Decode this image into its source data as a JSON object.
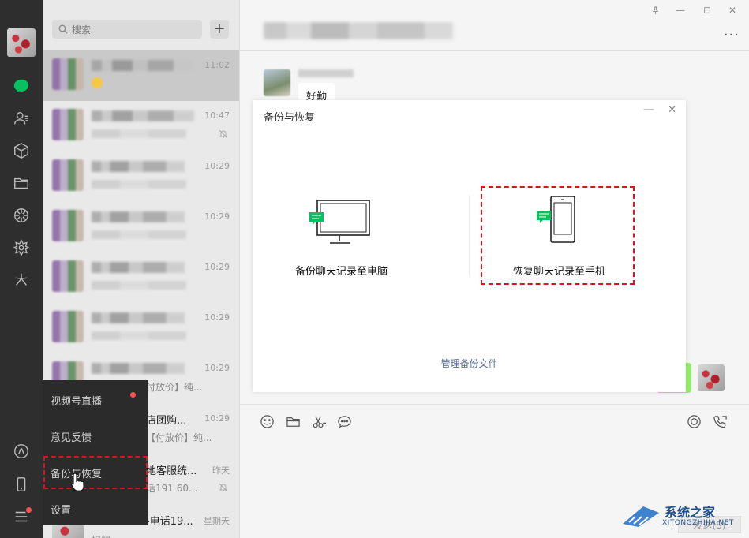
{
  "search": {
    "placeholder": "搜索"
  },
  "list_items": [
    {
      "time": "11:02",
      "active": true
    },
    {
      "time": "10:47",
      "muted": true
    },
    {
      "time": "10:29"
    },
    {
      "time": "10:29"
    },
    {
      "time": "10:29"
    },
    {
      "time": "10:29"
    },
    {
      "time": "10:29",
      "msg_tail": "付放价】纯..."
    },
    {
      "time": "10:29",
      "name_tail": "店团购...",
      "msg_tail": "【付放价】纯..."
    },
    {
      "time": "昨天",
      "name_tail": "地客服统...",
      "msg_tail": "话191 60...",
      "muted": true
    },
    {
      "time": "星期天",
      "name_tail": "-电话19...",
      "msg_tail": "好的"
    }
  ],
  "popup_menu": [
    {
      "label": "视频号直播",
      "dot": true
    },
    {
      "label": "意见反馈"
    },
    {
      "label": "备份与恢复",
      "highlighted": true
    },
    {
      "label": "设置"
    }
  ],
  "chat": {
    "bubble_text": "好勤"
  },
  "dialog": {
    "title": "备份与恢复",
    "backup_label": "备份聊天记录至电脑",
    "restore_label": "恢复聊天记录至手机",
    "manage_link": "管理备份文件"
  },
  "send_button": "发送(S)",
  "watermark": {
    "name": "系统之家",
    "url": "XITONGZHIJIA.NET"
  },
  "colors": {
    "nav_bg": "#2e2e2e",
    "accent_green": "#07c160",
    "highlight_red": "#d8141c",
    "link_blue": "#576b95"
  }
}
